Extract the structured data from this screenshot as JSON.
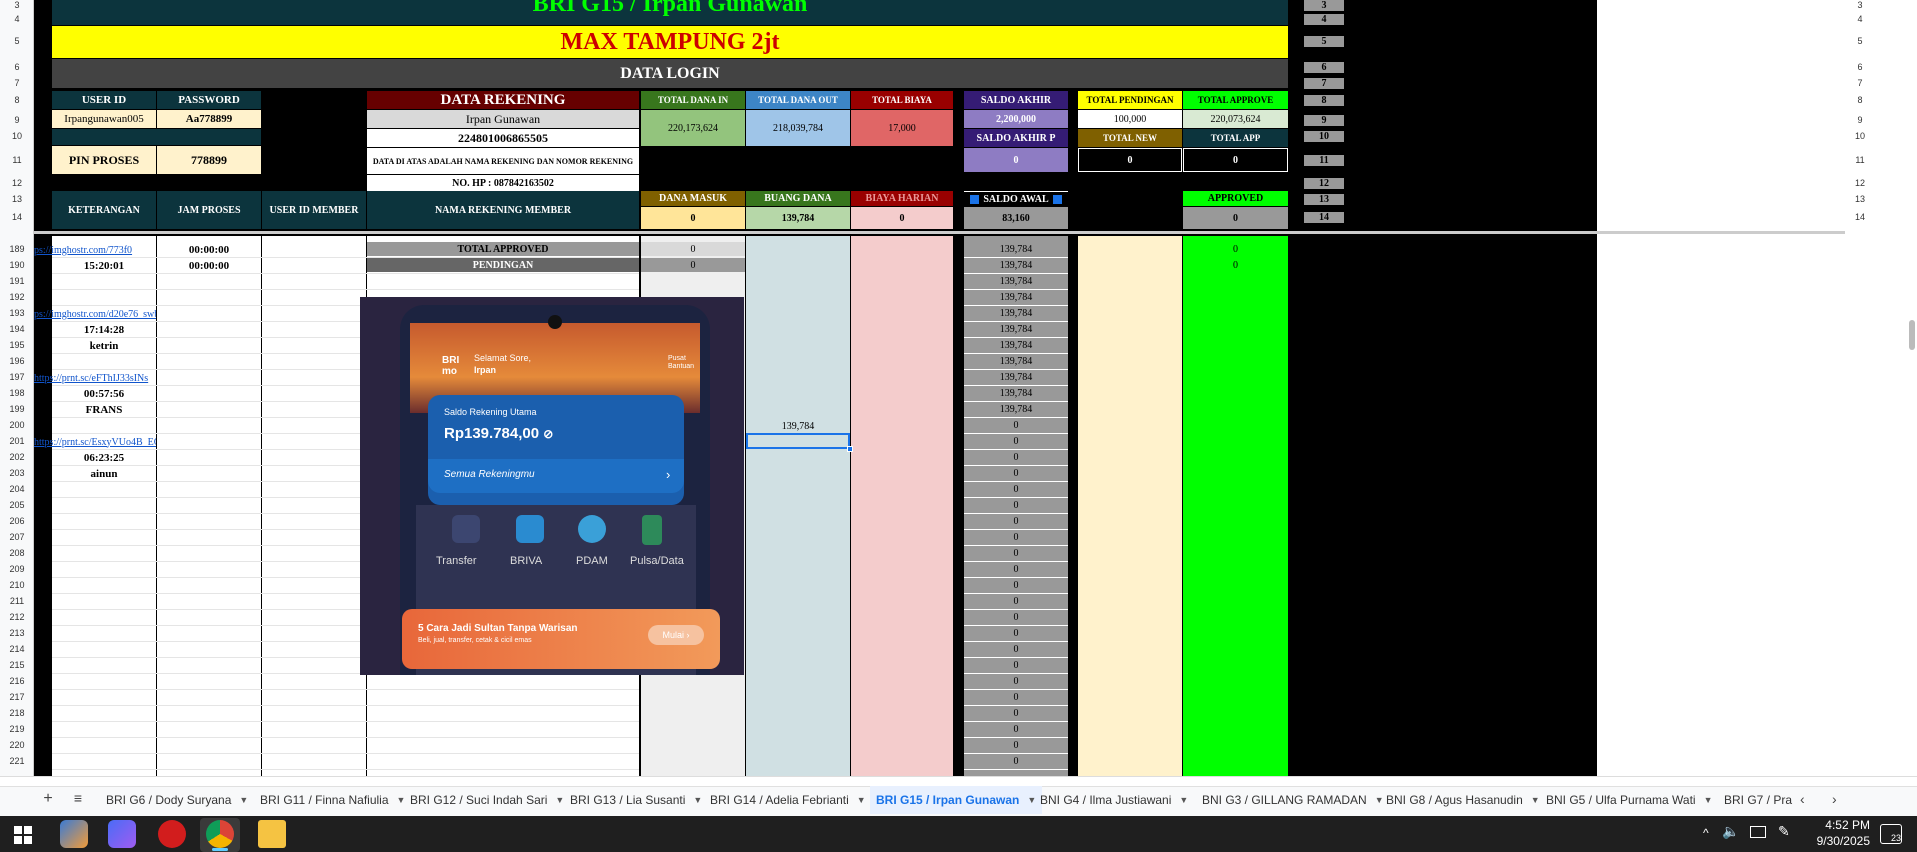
{
  "sheet": {
    "title": "BRI G15 / Irpan Gunawan",
    "banner": "MAX TAMPUNG 2jt",
    "data_login": "DATA LOGIN",
    "login": {
      "user_id_label": "USER ID",
      "password_label": "PASSWORD",
      "user_id": "Irpangunawan005",
      "password": "Aa778899",
      "pin_label": "PIN PROSES",
      "pin": "778899"
    },
    "rekening": {
      "header": "DATA REKENING",
      "name": "Irpan Gunawan",
      "number": "224801006865505",
      "note": "DATA DI ATAS ADALAH NAMA REKENING DAN NOMOR REKENING",
      "phone": "NO. HP : 087842163502"
    },
    "totals": {
      "dana_in_label": "TOTAL DANA IN",
      "dana_in": "220,173,624",
      "dana_out_label": "TOTAL DANA OUT",
      "dana_out": "218,039,784",
      "biaya_label": "TOTAL BIAYA",
      "biaya": "17,000",
      "saldo_akhir_label": "SALDO AKHIR",
      "saldo_akhir": "2,200,000",
      "saldo_akhir_p_label": "SALDO AKHIR P",
      "saldo_akhir_p": "0",
      "pendingan_label": "TOTAL PENDINGAN",
      "pendingan": "100,000",
      "approve_label": "TOTAL APPROVE",
      "approve": "220,073,624",
      "new_label": "TOTAL NEW",
      "new": "0",
      "app_label": "TOTAL APP",
      "app": "0"
    },
    "headers": {
      "keterangan": "KETERANGAN",
      "jam_proses": "JAM PROSES",
      "user_id_member": "USER ID MEMBER",
      "nama_rekening_member": "NAMA REKENING MEMBER",
      "dana_masuk": "DANA MASUK",
      "buang_dana": "BUANG DANA",
      "biaya_harian": "BIAYA HARIAN",
      "saldo_awal": "SALDO AWAL",
      "approved": "APPROVED"
    },
    "header_values": {
      "dana_masuk": "0",
      "buang_dana": "139,784",
      "biaya_harian": "0",
      "saldo_awal": "83,160",
      "approved": "0"
    },
    "summary": {
      "total_approved": "TOTAL APPROVED",
      "total_approved_val": "0",
      "pendingan": "PENDINGAN",
      "pendingan_val": "0",
      "approved_189": "0",
      "approved_190": "0"
    },
    "rows": [
      {
        "n": "189",
        "ket": "ps://imghostr.com/773f0",
        "link": true,
        "jam": "00:00:00",
        "saldo": "139,784"
      },
      {
        "n": "190",
        "ket": "15:20:01",
        "link": false,
        "jam": "00:00:00",
        "saldo": "139,784"
      },
      {
        "n": "191",
        "ket": "",
        "link": false,
        "jam": "",
        "saldo": "139,784"
      },
      {
        "n": "192",
        "ket": "",
        "link": false,
        "jam": "",
        "saldo": "139,784"
      },
      {
        "n": "193",
        "ket": "ps://imghostr.com/d20e76_swb",
        "link": true,
        "jam": "",
        "saldo": "139,784"
      },
      {
        "n": "194",
        "ket": "17:14:28",
        "link": false,
        "jam": "",
        "saldo": "139,784"
      },
      {
        "n": "195",
        "ket": "ketrin",
        "link": false,
        "jam": "",
        "saldo": "139,784"
      },
      {
        "n": "196",
        "ket": "",
        "link": false,
        "jam": "",
        "saldo": "139,784"
      },
      {
        "n": "197",
        "ket": "https://prnt.sc/eFThIJ33sINs",
        "link": true,
        "jam": "",
        "saldo": "139,784"
      },
      {
        "n": "198",
        "ket": "00:57:56",
        "link": false,
        "jam": "",
        "saldo": "139,784"
      },
      {
        "n": "199",
        "ket": "FRANS",
        "link": false,
        "jam": "",
        "saldo": "139,784"
      },
      {
        "n": "200",
        "ket": "",
        "link": false,
        "jam": "",
        "saldo": "0",
        "buang": "139,784"
      },
      {
        "n": "201",
        "ket": "https://prnt.sc/EsxyVUo4B_EG",
        "link": true,
        "jam": "",
        "saldo": "0"
      },
      {
        "n": "202",
        "ket": "06:23:25",
        "link": false,
        "jam": "",
        "saldo": "0"
      },
      {
        "n": "203",
        "ket": "ainun",
        "link": false,
        "jam": "",
        "saldo": "0"
      },
      {
        "n": "204",
        "ket": "",
        "link": false,
        "jam": "",
        "saldo": "0"
      },
      {
        "n": "205",
        "ket": "",
        "link": false,
        "jam": "",
        "saldo": "0"
      },
      {
        "n": "206",
        "ket": "",
        "link": false,
        "jam": "",
        "saldo": "0"
      },
      {
        "n": "207",
        "ket": "",
        "link": false,
        "jam": "",
        "saldo": "0"
      },
      {
        "n": "208",
        "ket": "",
        "link": false,
        "jam": "",
        "saldo": "0"
      },
      {
        "n": "209",
        "ket": "",
        "link": false,
        "jam": "",
        "saldo": "0"
      },
      {
        "n": "210",
        "ket": "",
        "link": false,
        "jam": "",
        "saldo": "0"
      },
      {
        "n": "211",
        "ket": "",
        "link": false,
        "jam": "",
        "saldo": "0"
      },
      {
        "n": "212",
        "ket": "",
        "link": false,
        "jam": "",
        "saldo": "0"
      },
      {
        "n": "213",
        "ket": "",
        "link": false,
        "jam": "",
        "saldo": "0"
      },
      {
        "n": "214",
        "ket": "",
        "link": false,
        "jam": "",
        "saldo": "0"
      },
      {
        "n": "215",
        "ket": "",
        "link": false,
        "jam": "",
        "saldo": "0"
      },
      {
        "n": "216",
        "ket": "",
        "link": false,
        "jam": "",
        "saldo": "0"
      },
      {
        "n": "217",
        "ket": "",
        "link": false,
        "jam": "",
        "saldo": "0"
      },
      {
        "n": "218",
        "ket": "",
        "link": false,
        "jam": "",
        "saldo": "0"
      },
      {
        "n": "219",
        "ket": "",
        "link": false,
        "jam": "",
        "saldo": "0"
      },
      {
        "n": "220",
        "ket": "",
        "link": false,
        "jam": "",
        "saldo": "0"
      },
      {
        "n": "221",
        "ket": "",
        "link": false,
        "jam": "",
        "saldo": "0"
      }
    ],
    "top_rows": [
      "3",
      "4",
      "5",
      "6",
      "7",
      "8",
      "9",
      "10",
      "11",
      "12",
      "13",
      "14"
    ]
  },
  "phone_image": {
    "greeting": "Selamat Sore,",
    "user": "Irpan",
    "help": "Pusat Bantuan",
    "card_label": "Saldo Rekening Utama",
    "balance": "Rp139.784,00",
    "all_accounts": "Semua Rekeningmu",
    "menu": [
      "Transfer",
      "BRIVA",
      "PDAM",
      "Pulsa/Data"
    ],
    "promo": "5 Cara Jadi Sultan Tanpa Warisan",
    "promo_sub": "Beli, jual, transfer, cetak & cicil emas",
    "promo_btn": "Mulai"
  },
  "tabs": [
    "BRI G6 / Dody Suryana",
    "BRI G11 / Finna Nafiulia",
    "BRI G12 / Suci Indah Sari",
    "BRI G13 / Lia Susanti",
    "BRI G14 / Adelia Febrianti",
    "BRI G15 / Irpan Gunawan",
    "BNI G4 / Ilma Justiawani",
    "BNI G3 / GILLANG RAMADAN",
    "BNI G8 / Agus Hasanudin",
    "BNI G5 / Ulfa Purnama Wati",
    "BRI G7 / Pra"
  ],
  "taskbar": {
    "time": "4:52 PM",
    "date": "9/30/2025",
    "badge": "23"
  },
  "colors": {
    "dark_teal": "#0c343d",
    "yellow": "#ffff00",
    "dark_gray": "#434343",
    "maroon": "#660000",
    "green_light": "#93c47d",
    "blue_light": "#9fc5e8",
    "red_light": "#e06666",
    "purple": "#8e7cc3",
    "bright_green": "#00ff00",
    "brown": "#7f6000"
  }
}
